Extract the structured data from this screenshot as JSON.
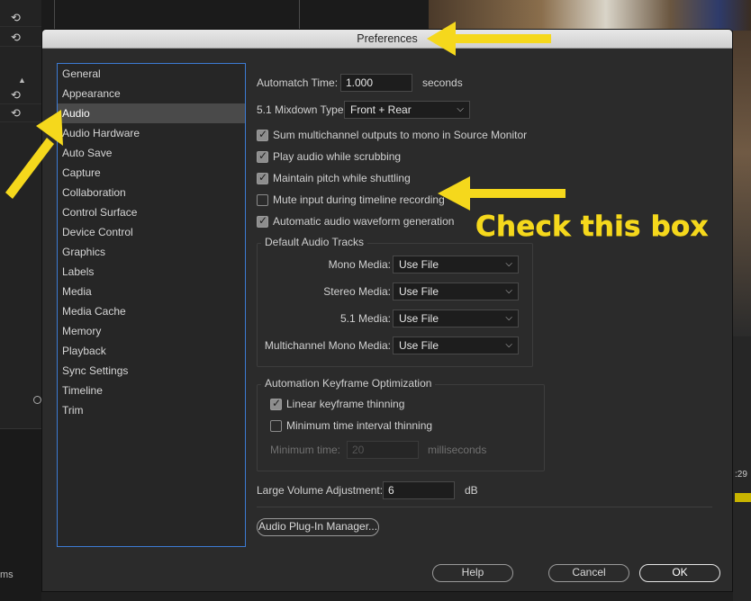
{
  "background": {
    "bottom_left_text": "ms",
    "timecode_fragment": ":29"
  },
  "dialog": {
    "title": "Preferences"
  },
  "sidebar": {
    "items": [
      {
        "label": "General"
      },
      {
        "label": "Appearance"
      },
      {
        "label": "Audio",
        "selected": true
      },
      {
        "label": "Audio Hardware"
      },
      {
        "label": "Auto Save"
      },
      {
        "label": "Capture"
      },
      {
        "label": "Collaboration"
      },
      {
        "label": "Control Surface"
      },
      {
        "label": "Device Control"
      },
      {
        "label": "Graphics"
      },
      {
        "label": "Labels"
      },
      {
        "label": "Media"
      },
      {
        "label": "Media Cache"
      },
      {
        "label": "Memory"
      },
      {
        "label": "Playback"
      },
      {
        "label": "Sync Settings"
      },
      {
        "label": "Timeline"
      },
      {
        "label": "Trim"
      }
    ]
  },
  "audio": {
    "automatch_label": "Automatch Time:",
    "automatch_value": "1.000",
    "automatch_unit": "seconds",
    "mixdown_label": "5.1 Mixdown Type:",
    "mixdown_value": "Front + Rear",
    "checkboxes": [
      {
        "label": "Sum multichannel outputs to mono in Source Monitor",
        "checked": true
      },
      {
        "label": "Play audio while scrubbing",
        "checked": true
      },
      {
        "label": "Maintain pitch while shuttling",
        "checked": true
      },
      {
        "label": "Mute input during timeline recording",
        "checked": false
      },
      {
        "label": "Automatic audio waveform generation",
        "checked": true
      }
    ],
    "default_tracks": {
      "title": "Default Audio Tracks",
      "rows": [
        {
          "label": "Mono Media:",
          "value": "Use File"
        },
        {
          "label": "Stereo Media:",
          "value": "Use File"
        },
        {
          "label": "5.1 Media:",
          "value": "Use File"
        },
        {
          "label": "Multichannel Mono Media:",
          "value": "Use File"
        }
      ]
    },
    "keyframe": {
      "title": "Automation Keyframe Optimization",
      "linear_label": "Linear keyframe thinning",
      "linear_checked": true,
      "min_interval_label": "Minimum time interval thinning",
      "min_interval_checked": false,
      "min_time_label": "Minimum time:",
      "min_time_value": "20",
      "min_time_unit": "milliseconds"
    },
    "large_volume_label": "Large Volume Adjustment:",
    "large_volume_value": "6",
    "large_volume_unit": "dB",
    "plugin_button": "Audio Plug-In Manager..."
  },
  "buttons": {
    "help": "Help",
    "cancel": "Cancel",
    "ok": "OK"
  },
  "annotation": {
    "text": "Check this box",
    "color": "#f5d81c"
  }
}
